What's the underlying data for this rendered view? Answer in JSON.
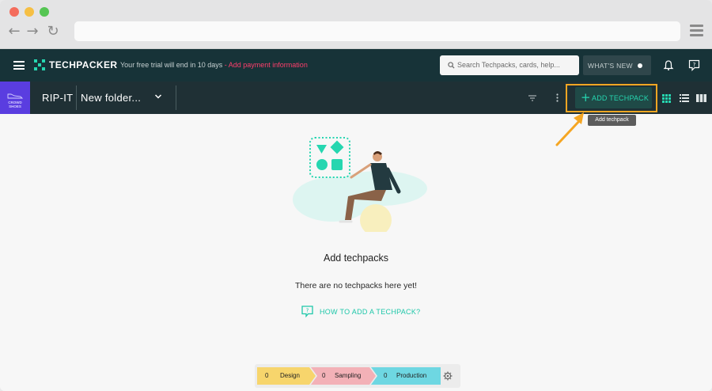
{
  "colors": {
    "topbar": "#173338",
    "subbar": "#1f3035",
    "accent": "#26d6b0",
    "trial_link": "#ff3e6c",
    "highlight": "#f5a623",
    "design_stage": "#f7d56c",
    "sampling_stage": "#f3b1b7",
    "production_stage": "#6ed7e2"
  },
  "app": {
    "logo": "TECHPACKER",
    "trial_text": "Your free trial will end in 10 days",
    "trial_separator": " - ",
    "trial_link": "Add payment information",
    "search_placeholder": "Search Techpacks, cards, help...",
    "whats_new": "WHAT'S NEW"
  },
  "subbar": {
    "brand_lines": [
      "CROWD",
      "SHOES"
    ],
    "project": "RIP-IT",
    "folder": "New folder...",
    "add_button": "ADD TECHPACK",
    "tooltip": "Add techpack"
  },
  "main": {
    "title": "Add techpacks",
    "subtitle": "There are no techpacks here yet!",
    "howto": "HOW TO ADD A TECHPACK?"
  },
  "pipeline": {
    "stages": [
      {
        "count": "0",
        "name": "Design"
      },
      {
        "count": "0",
        "name": "Sampling"
      },
      {
        "count": "0",
        "name": "Production"
      }
    ]
  }
}
